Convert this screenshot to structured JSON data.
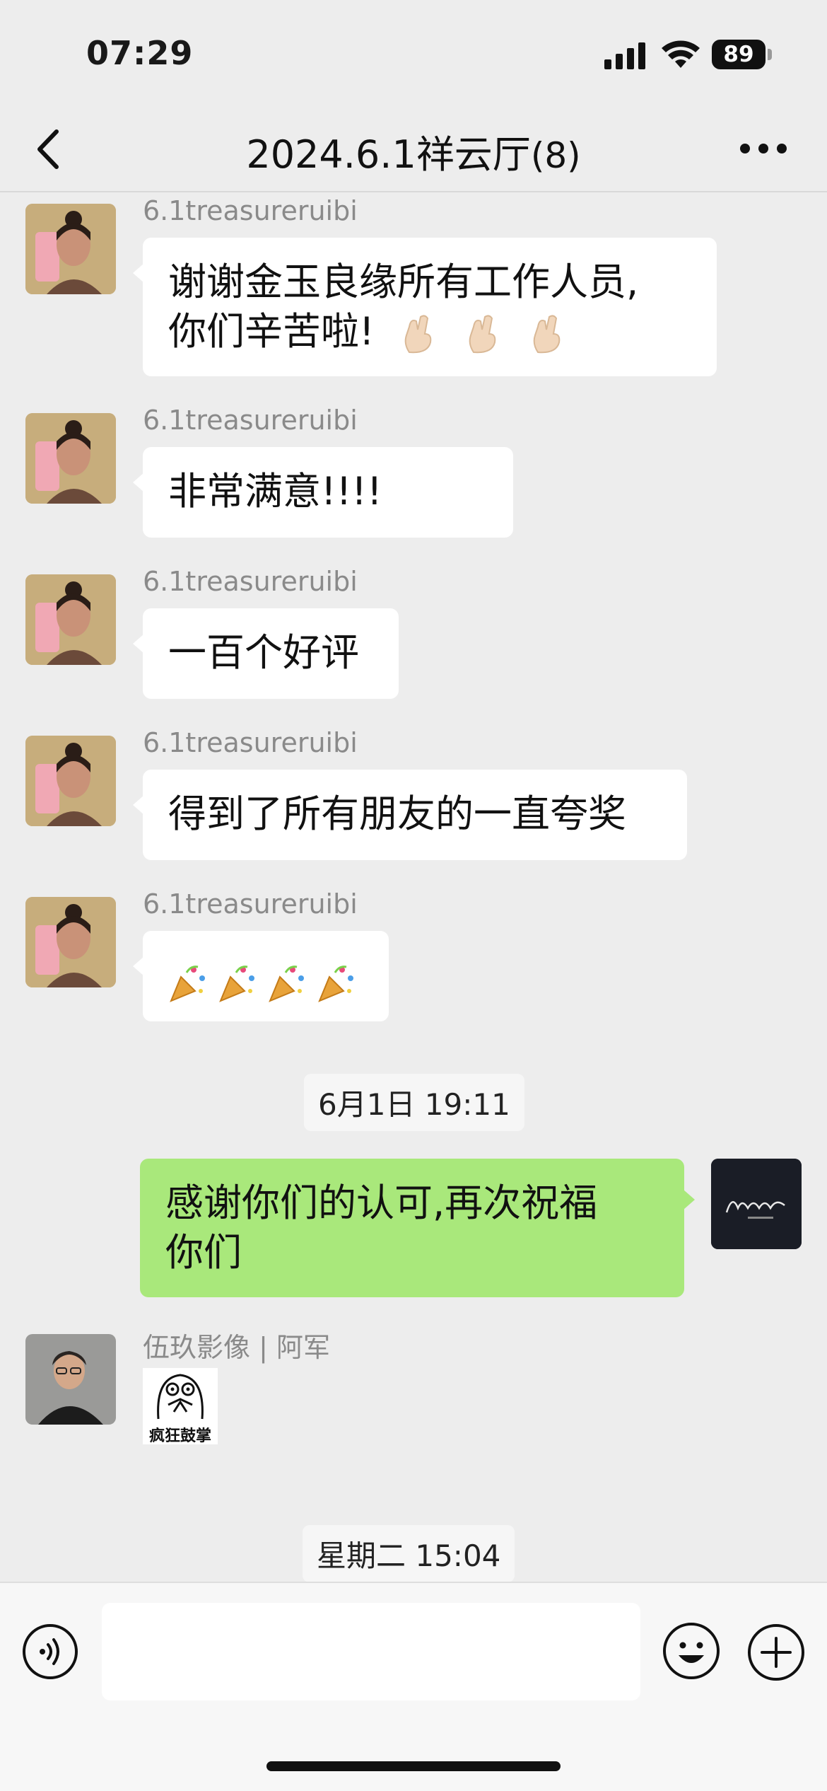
{
  "status": {
    "time": "07:29",
    "battery": "89"
  },
  "nav": {
    "title": "2024.6.1祥云厅",
    "member_count": "(8)"
  },
  "messages": [
    {
      "sender": "6.1treasureruibi",
      "text_line1": "谢谢金玉良缘所有工作人员,",
      "text_line2": "你们辛苦啦!"
    },
    {
      "sender": "6.1treasureruibi",
      "text": "非常满意!!!!"
    },
    {
      "sender": "6.1treasureruibi",
      "text": "一百个好评"
    },
    {
      "sender": "6.1treasureruibi",
      "text": "得到了所有朋友的一直夸奖"
    },
    {
      "sender": "6.1treasureruibi"
    }
  ],
  "timestamps": {
    "first": "6月1日 19:11",
    "second": "星期二 15:04"
  },
  "self_message": {
    "line1": "感谢你们的认可,再次祝福",
    "line2": "你们",
    "avatar_text": "Avante"
  },
  "photographer": {
    "sender": "伍玖影像 | 阿军",
    "sticker_caption": "疯狂鼓掌"
  },
  "icons": {
    "back": "chevron-left-icon",
    "more": "more-dots-icon",
    "voice": "voice-icon",
    "emoji": "emoji-icon",
    "plus": "plus-icon"
  },
  "colors": {
    "background": "#ededed",
    "self_bubble": "#a9e87b",
    "other_bubble": "#ffffff"
  }
}
